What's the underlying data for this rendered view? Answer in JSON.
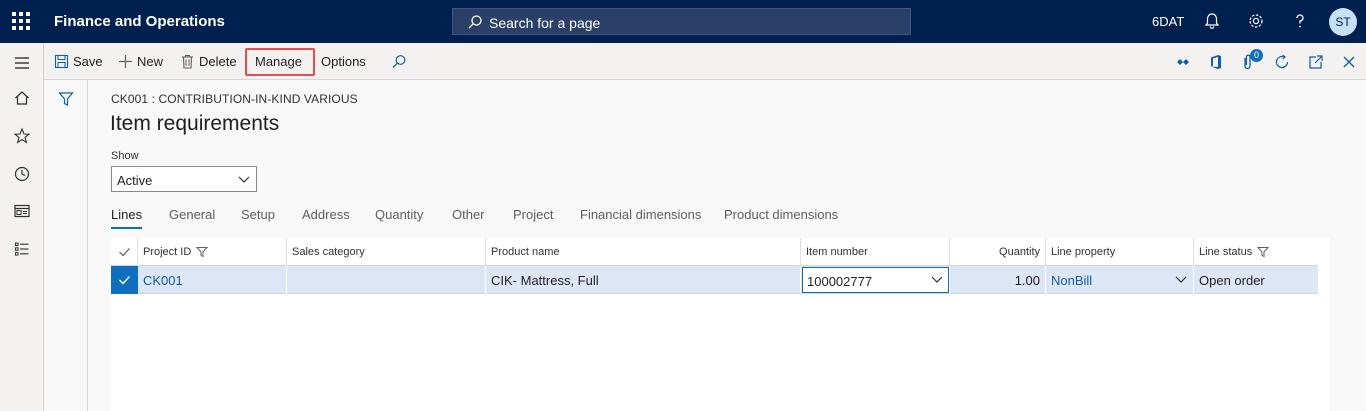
{
  "topbar": {
    "app_title": "Finance and Operations",
    "search_placeholder": "Search for a page",
    "company": "6DAT",
    "user_initials": "ST"
  },
  "actions": {
    "save": "Save",
    "new": "New",
    "delete": "Delete",
    "manage": "Manage",
    "options": "Options"
  },
  "notification_count": "0",
  "page": {
    "breadcrumb": "CK001 : CONTRIBUTION-IN-KIND VARIOUS",
    "title": "Item requirements",
    "show_label": "Show",
    "show_value": "Active"
  },
  "tabs": [
    "Lines",
    "General",
    "Setup",
    "Address",
    "Quantity",
    "Other",
    "Project",
    "Financial dimensions",
    "Product dimensions"
  ],
  "grid": {
    "headers": [
      "Project ID",
      "Sales category",
      "Product name",
      "Item number",
      "Quantity",
      "Line property",
      "Line status"
    ],
    "rows": [
      {
        "project_id": "CK001",
        "sales_category": "",
        "product_name": "CIK- Mattress, Full",
        "item_number": "100002777",
        "quantity": "1.00",
        "line_property": "NonBill",
        "line_status": "Open order"
      }
    ]
  },
  "colors": {
    "topbar": "#002050",
    "accent": "#0f6cbd",
    "selected_row": "#dce6f4",
    "highlight_box": "#e05050"
  }
}
